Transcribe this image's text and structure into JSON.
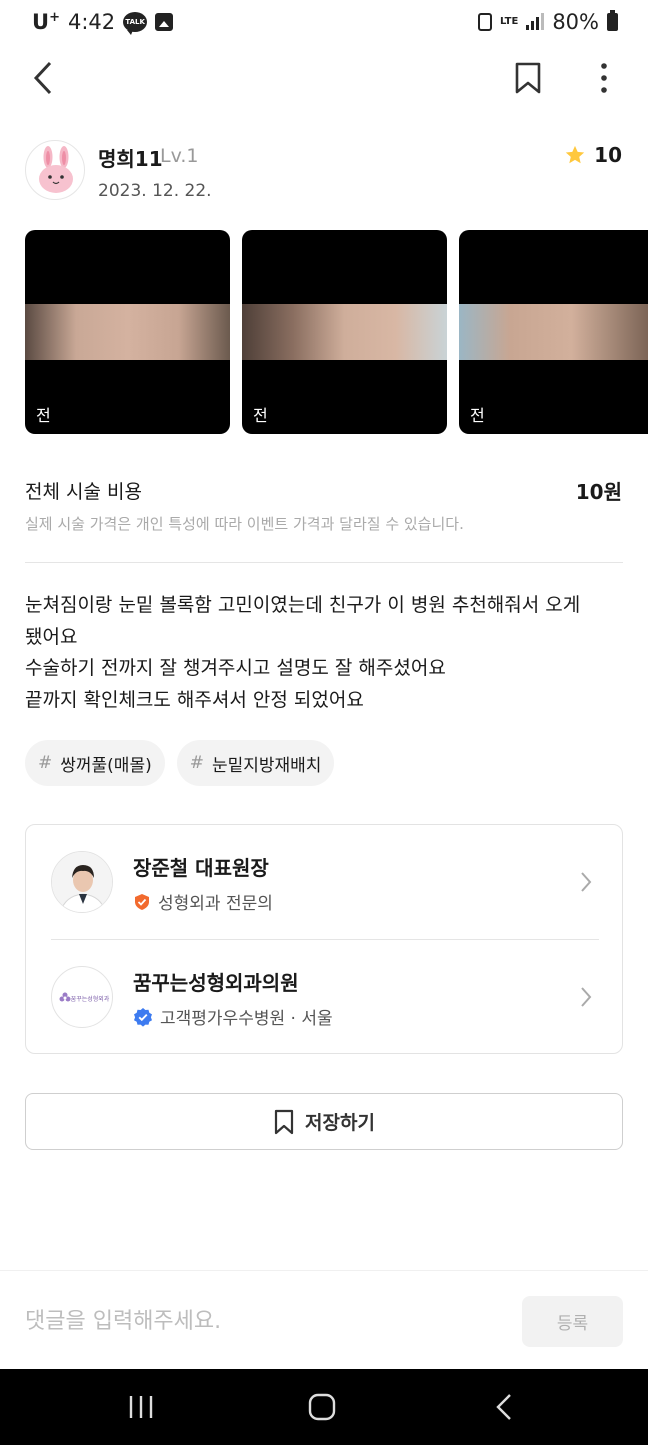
{
  "status_bar": {
    "carrier": "U",
    "carrier_sup": "+",
    "time": "4:42",
    "talk_badge": "TALK",
    "network": "LTE",
    "battery": "80%"
  },
  "author": {
    "name": "명희11",
    "level": "Lv.1",
    "date": "2023. 12. 22.",
    "rating": "10"
  },
  "photos": [
    {
      "label": "전"
    },
    {
      "label": "전"
    },
    {
      "label": "전"
    }
  ],
  "price": {
    "label": "전체 시술 비용",
    "value": "10원",
    "note": "실제 시술 가격은 개인 특성에 따라 이벤트 가격과 달라질 수 있습니다."
  },
  "review": {
    "lines": [
      "눈쳐짐이랑 눈밑 볼록함 고민이였는데 친구가 이 병원 추천해줘서 오게",
      "됐어요",
      "수술하기 전까지 잘 챙겨주시고 설명도 잘 해주셨어요",
      "끝까지 확인체크도 해주셔서 안정 되었어요"
    ]
  },
  "tags": [
    {
      "hash": "#",
      "label": "쌍꺼풀(매몰)"
    },
    {
      "hash": "#",
      "label": "눈밑지방재배치"
    }
  ],
  "doctor": {
    "name": "장준철 대표원장",
    "badge": "성형외과 전문의",
    "badge_color": "#f26a2e"
  },
  "hospital": {
    "name": "꿈꾸는성형외과의원",
    "badge": "고객평가우수병원 · 서울",
    "badge_color": "#3d7bf0",
    "logo_text": "꿈꾸는성형외과"
  },
  "save_button": {
    "label": "저장하기"
  },
  "comment": {
    "placeholder": "댓글을 입력해주세요.",
    "submit_label": "등록"
  },
  "colors": {
    "star": "#ffc83d",
    "photo_bg": "#000000"
  }
}
